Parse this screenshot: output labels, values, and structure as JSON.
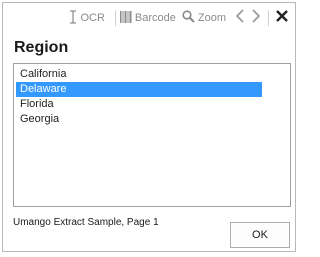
{
  "toolbar": {
    "ocr_label": "OCR",
    "barcode_label": "Barcode",
    "zoom_label": "Zoom",
    "icons": {
      "ocr": "text-cursor-icon",
      "barcode": "barcode-icon",
      "zoom": "magnifier-icon",
      "prev": "chevron-left-icon",
      "next": "chevron-right-icon",
      "close": "close-icon"
    }
  },
  "dialog": {
    "title": "Region",
    "items": [
      {
        "label": "California",
        "selected": false
      },
      {
        "label": "Delaware",
        "selected": true
      },
      {
        "label": "Florida",
        "selected": false
      },
      {
        "label": "Georgia",
        "selected": false
      }
    ],
    "footer_text": "Umango Extract Sample, Page 1",
    "ok_label": "OK"
  },
  "colors": {
    "selection": "#3399ff",
    "toolbar_text": "#8a8a8a"
  }
}
